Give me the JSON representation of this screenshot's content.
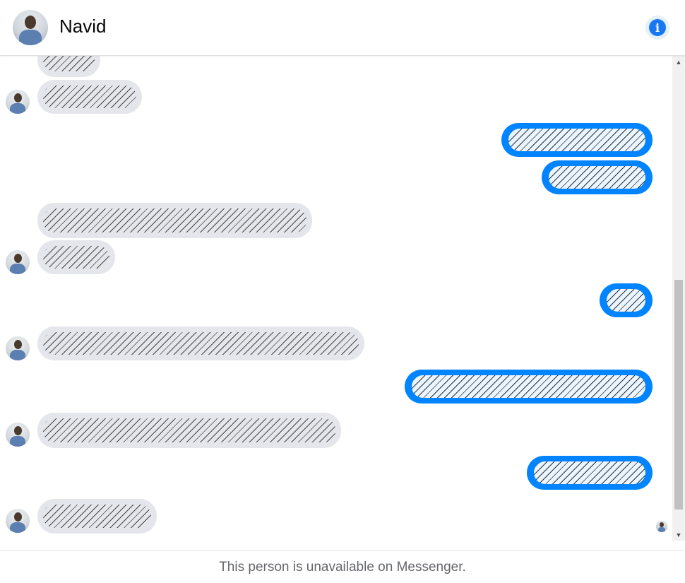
{
  "header": {
    "contact_name": "Navid",
    "avatar_icon": "profile-photo",
    "info_icon": "info-icon",
    "info_glyph": "i"
  },
  "thread": {
    "messages": [
      {
        "from": "contact",
        "content": "redacted"
      },
      {
        "from": "contact",
        "content": "redacted"
      },
      {
        "from": "me",
        "content": "redacted"
      },
      {
        "from": "me",
        "content": "redacted"
      },
      {
        "from": "contact",
        "content": "redacted"
      },
      {
        "from": "contact",
        "content": "redacted"
      },
      {
        "from": "me",
        "content": "redacted"
      },
      {
        "from": "contact",
        "content": "redacted"
      },
      {
        "from": "me",
        "content": "redacted"
      },
      {
        "from": "contact",
        "content": "redacted"
      },
      {
        "from": "me",
        "content": "redacted"
      },
      {
        "from": "contact",
        "content": "redacted"
      }
    ]
  },
  "scrollbar": {
    "up_arrow": "▲",
    "down_arrow": "▼"
  },
  "footer": {
    "status_text": "This person is unavailable on Messenger."
  },
  "colors": {
    "outgoing_bubble": "#0084ff",
    "incoming_bubble": "#e4e6eb",
    "accent": "#1877f2",
    "footer_text": "#65676b"
  }
}
